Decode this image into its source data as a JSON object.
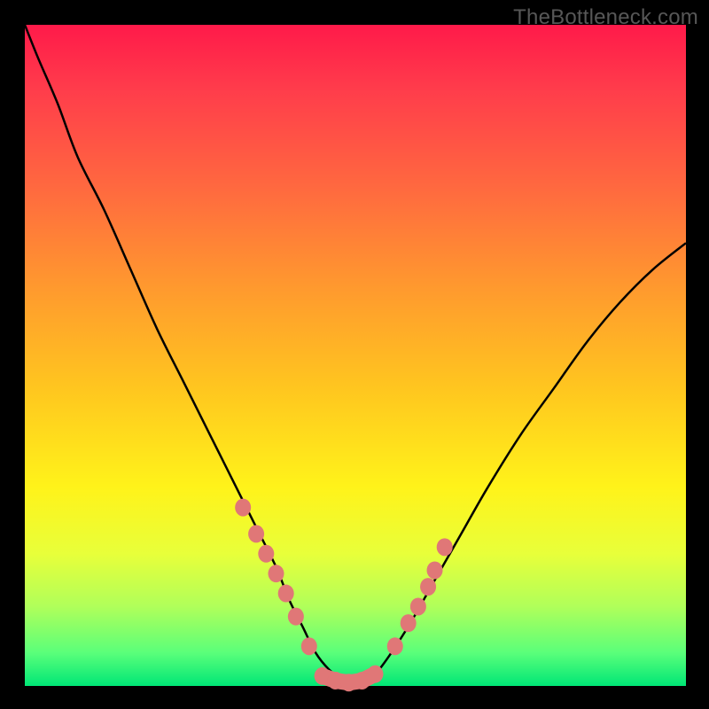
{
  "watermark": "TheBottleneck.com",
  "colors": {
    "page_bg": "#000000",
    "gradient_top": "#ff1a4a",
    "gradient_bottom": "#00e676",
    "curve_stroke": "#000000",
    "marker_fill": "#e07777",
    "marker_stroke": "#e07777"
  },
  "chart_data": {
    "type": "line",
    "title": "",
    "xlabel": "",
    "ylabel": "",
    "xlim": [
      0,
      100
    ],
    "ylim": [
      0,
      100
    ],
    "series": [
      {
        "name": "bottleneck-curve",
        "x": [
          0,
          2,
          5,
          8,
          12,
          16,
          20,
          24,
          28,
          32,
          35,
          38,
          40,
          42,
          44,
          46,
          48,
          50,
          52,
          54,
          58,
          62,
          66,
          70,
          75,
          80,
          85,
          90,
          95,
          100
        ],
        "y": [
          100,
          95,
          88,
          80,
          72,
          63,
          54,
          46,
          38,
          30,
          24,
          18,
          13,
          9,
          5,
          2.5,
          1,
          0.5,
          1,
          3,
          9,
          16,
          23,
          30,
          38,
          45,
          52,
          58,
          63,
          67
        ]
      }
    ],
    "markers": {
      "left_cluster_x": [
        33,
        35,
        36.5,
        38,
        39.5,
        41,
        43
      ],
      "left_cluster_y": [
        27,
        23,
        20,
        17,
        14,
        10.5,
        6
      ],
      "bottom_cluster_x": [
        45,
        47,
        49,
        51,
        53
      ],
      "bottom_cluster_y": [
        1.5,
        0.8,
        0.5,
        0.8,
        1.8
      ],
      "right_cluster_x": [
        56,
        58,
        59.5,
        61,
        62,
        63.5
      ],
      "right_cluster_y": [
        6,
        9.5,
        12,
        15,
        17.5,
        21
      ]
    }
  }
}
